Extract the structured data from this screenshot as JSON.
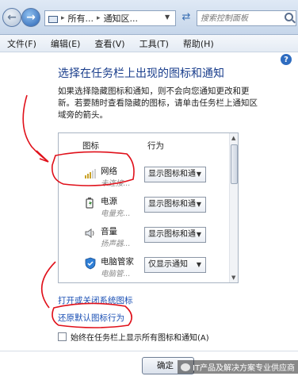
{
  "addressbar": {
    "path_1": "所有...",
    "path_2": "通知区...",
    "search_placeholder": "搜索控制面板"
  },
  "menu": {
    "items": [
      {
        "label": "文件(F)"
      },
      {
        "label": "编辑(E)"
      },
      {
        "label": "查看(V)"
      },
      {
        "label": "工具(T)"
      },
      {
        "label": "帮助(H)"
      }
    ]
  },
  "content": {
    "title": "选择在任务栏上出现的图标和通知",
    "description": "如果选择隐藏图标和通知，则不会向您通知更改和更新。若要随时查看隐藏的图标，请单击任务栏上通知区域旁的箭头。",
    "table": {
      "col_icon": "图标",
      "col_behavior": "行为",
      "rows": [
        {
          "name": "网络",
          "status": "未连接...",
          "behavior": "显示图标和通",
          "icon": "network-icon"
        },
        {
          "name": "电源",
          "status": "电量充...",
          "behavior": "显示图标和通",
          "icon": "power-icon"
        },
        {
          "name": "音量",
          "status": "扬声器...",
          "behavior": "显示图标和通",
          "icon": "volume-icon"
        },
        {
          "name": "电脑管家",
          "status": "电脑管...",
          "behavior": "仅显示通知",
          "icon": "shield-icon"
        }
      ]
    },
    "link_system_icons": "打开或关闭系统图标",
    "link_restore": "还原默认图标行为",
    "checkbox_label": "始终在任务栏上显示所有图标和通知(A)"
  },
  "footer": {
    "ok_label": "确定",
    "watermark": "IT产品及解决方案专业供应商"
  },
  "colors": {
    "title": "#1a3e8c",
    "link": "#1a4fb4",
    "annotation": "#e0101a"
  }
}
